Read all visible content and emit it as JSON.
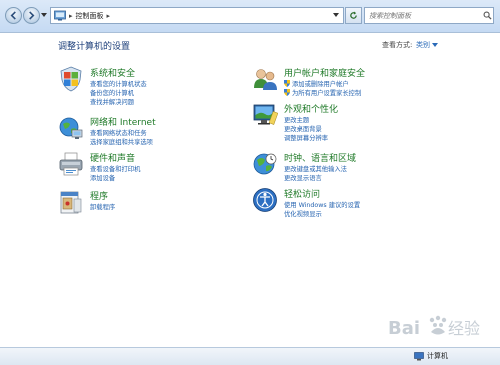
{
  "address_bar": {
    "path": [
      "控制面板"
    ]
  },
  "search": {
    "placeholder": "搜索控制面板"
  },
  "page": {
    "title": "调整计算机的设置",
    "view_by_label": "查看方式:",
    "view_by_value": "类别"
  },
  "categories": [
    {
      "title": "系统和安全",
      "icon": "shield-flag-icon",
      "links": [
        "查看您的计算机状态",
        "备份您的计算机",
        "查找并解决问题"
      ]
    },
    {
      "title": "网络和 Internet",
      "icon": "network-globe-icon",
      "links": [
        "查看网络状态和任务",
        "选择家庭组和共享选项"
      ]
    },
    {
      "title": "硬件和声音",
      "icon": "printer-icon",
      "links": [
        "查看设备和打印机",
        "添加设备"
      ]
    },
    {
      "title": "程序",
      "icon": "programs-icon",
      "links": [
        "卸载程序"
      ]
    },
    {
      "title": "用户帐户和家庭安全",
      "icon": "users-icon",
      "links": [
        "添加或删除用户帐户",
        "为所有用户设置家长控制"
      ]
    },
    {
      "title": "外观和个性化",
      "icon": "monitor-icon",
      "links": [
        "更改主题",
        "更改桌面背景",
        "调整屏幕分辨率"
      ]
    },
    {
      "title": "时钟、语言和区域",
      "icon": "clock-globe-icon",
      "links": [
        "更改键盘或其他输入法",
        "更改显示语言"
      ]
    },
    {
      "title": "轻松访问",
      "icon": "accessibility-icon",
      "links": [
        "使用 Windows 建议的设置",
        "优化视频显示"
      ]
    }
  ],
  "statusbar": {
    "text": "计算机"
  },
  "watermark": {
    "text": "Baidu 经验"
  },
  "colors": {
    "category_title": "#1f7a28",
    "link": "#2563b0",
    "page_title": "#1d3f7a"
  }
}
